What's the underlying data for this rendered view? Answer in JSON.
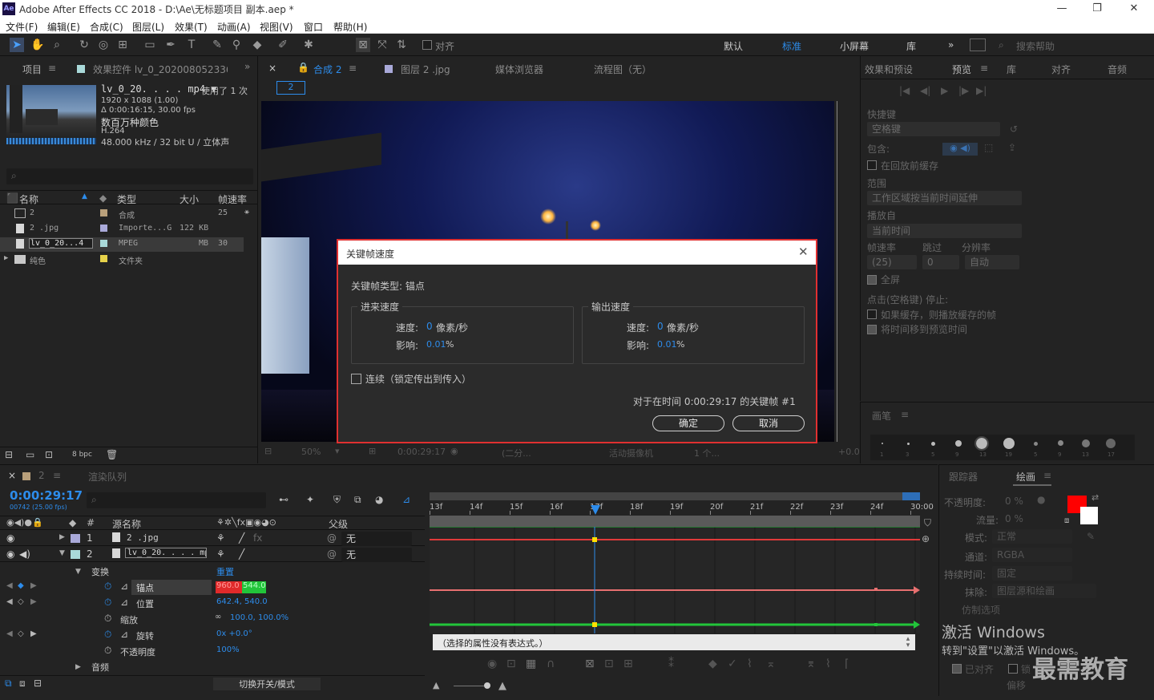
{
  "window": {
    "title": "Adobe After Effects CC 2018 - D:\\Ae\\无标题项目 副本.aep *",
    "app_icon": "Ae",
    "min": "—",
    "max": "❐",
    "close": "✕"
  },
  "menu": [
    "文件(F)",
    "编辑(E)",
    "合成(C)",
    "图层(L)",
    "效果(T)",
    "动画(A)",
    "视图(V)",
    "窗口",
    "帮助(H)"
  ],
  "toolbar": {
    "align_label": "对齐",
    "workspaces": [
      "默认",
      "标准",
      "小屏幕",
      "库"
    ],
    "active_workspace": "标准",
    "search_placeholder": "搜索帮助"
  },
  "project": {
    "tab_project": "项目",
    "tab_effects": "效果控件 lv_0_20200805233600",
    "footage_name": "lv_0_20. . . . mp4 ▼",
    "used": "，使用了 1 次",
    "resolution": "1920 x 1088 (1.00)",
    "duration": "Δ 0:00:16:15, 30.00 fps",
    "colors": "数百万种颜色",
    "codec": "H.264",
    "audio": "48.000 kHz / 32 bit U / 立体声",
    "columns": [
      "名称",
      "类型",
      "大小",
      "帧速率"
    ],
    "items": [
      {
        "name": "2",
        "type": "合成",
        "size": "",
        "fps": "25",
        "color": "#b9a07b"
      },
      {
        "name": "2 .jpg",
        "type": "Importe...G",
        "size": "122 KB",
        "fps": "",
        "color": "#a9a9d9"
      },
      {
        "name": "lv_0_20...4",
        "type": "MPEG",
        "size": "MB",
        "fps": "30",
        "color": "#a9d9d9"
      },
      {
        "name": "纯色",
        "type": "文件夹",
        "size": "",
        "fps": "",
        "color": "#e6d24a"
      }
    ],
    "bpc": "8 bpc"
  },
  "comp": {
    "tab_comp": "合成 2",
    "tab_layer": "图层 2 .jpg",
    "tab_media": "媒体浏览器",
    "tab_flow": "流程图（无）",
    "comp_sub": "2",
    "zoom": "50%",
    "timecode": "0:00:29:17",
    "quality": "(二分...",
    "camera": "活动摄像机",
    "views": "1 个...",
    "offset": "+0.0"
  },
  "dialog": {
    "title": "关键帧速度",
    "type_label": "关键帧类型: 锚点",
    "incoming": "进来速度",
    "outgoing": "输出速度",
    "speed_label": "速度:",
    "speed_value": "0",
    "speed_unit": "像素/秒",
    "influence_label": "影响:",
    "influence_value": "0.01",
    "influence_unit": "%",
    "continuous": "连续（锁定传出到传入）",
    "info": "对于在时间 0:00:29:17 的关键帧 #1",
    "ok": "确定",
    "cancel": "取消"
  },
  "preview": {
    "tab_effects": "效果和预设",
    "tab_preview": "预览",
    "tab_lib": "库",
    "tab_align": "对齐",
    "tab_audio": "音频",
    "shortcut": "快捷键",
    "shortcut_val": "空格键",
    "include": "包含:",
    "cache_before": "在回放前缓存",
    "range": "范围",
    "range_val": "工作区域按当前时间延伸",
    "play_from": "播放自",
    "play_from_val": "当前时间",
    "fps": "帧速率",
    "skip": "跳过",
    "resolution": "分辨率",
    "fps_val": "(25)",
    "skip_val": "0",
    "res_val": "自动",
    "fullscreen": "全屏",
    "stop_title": "点击(空格键) 停止:",
    "stop1": "如果缓存，则播放缓存的帧",
    "stop2": "将时间移到预览时间"
  },
  "brushes": {
    "tab": "画笔",
    "sizes": [
      "1",
      "3",
      "5",
      "9",
      "13",
      "19",
      "5",
      "9",
      "13",
      "17"
    ]
  },
  "timeline": {
    "tab_comp": "2",
    "tab_render": "渲染队列",
    "timecode": "0:00:29:17",
    "frames": "00742 (25.00 fps)",
    "ruler": [
      "13f",
      "14f",
      "15f",
      "16f",
      "17f",
      "18f",
      "19f",
      "20f",
      "21f",
      "22f",
      "23f",
      "24f",
      "30:00"
    ],
    "col_source": "源名称",
    "col_parent": "父级",
    "layers": [
      {
        "num": "1",
        "name": "2 .jpg",
        "parent": "无",
        "color": "#a9a9d9"
      },
      {
        "num": "2",
        "name": "lv_0_20. . . . mp4",
        "parent": "无",
        "color": "#a9d9d9"
      }
    ],
    "transform": "变换",
    "reset": "重置",
    "props": [
      {
        "name": "锚点",
        "v1": "960.0",
        "v2": "544.0"
      },
      {
        "name": "位置",
        "value": "642.4, 540.0"
      },
      {
        "name": "缩放",
        "value": "100.0, 100.0%"
      },
      {
        "name": "旋转",
        "value": "0x +0.0°"
      },
      {
        "name": "不透明度",
        "value": "100%"
      }
    ],
    "audio": "音频",
    "expr": "（选择的属性没有表达式。）",
    "switch_mode": "切换开关/模式"
  },
  "paint": {
    "tab_tracker": "跟踪器",
    "tab_paint": "绘画",
    "opacity": "不透明度:",
    "opacity_val": "0 %",
    "flow": "流量:",
    "flow_val": "0 %",
    "mode": "模式:",
    "mode_val": "正常",
    "channel": "通道:",
    "channel_val": "RGBA",
    "duration": "持续时间:",
    "duration_val": "固定",
    "erase": "抹除:",
    "erase_val": "图层源和绘画",
    "clone": "仿制选项",
    "aligned": "已对齐",
    "lock": "锁",
    "offset": "偏移",
    "fg_color": "#ff0000"
  },
  "watermark": {
    "activate": "激活 Windows",
    "hint": "转到\"设置\"以激活 Windows。",
    "brand": "最需教育"
  }
}
